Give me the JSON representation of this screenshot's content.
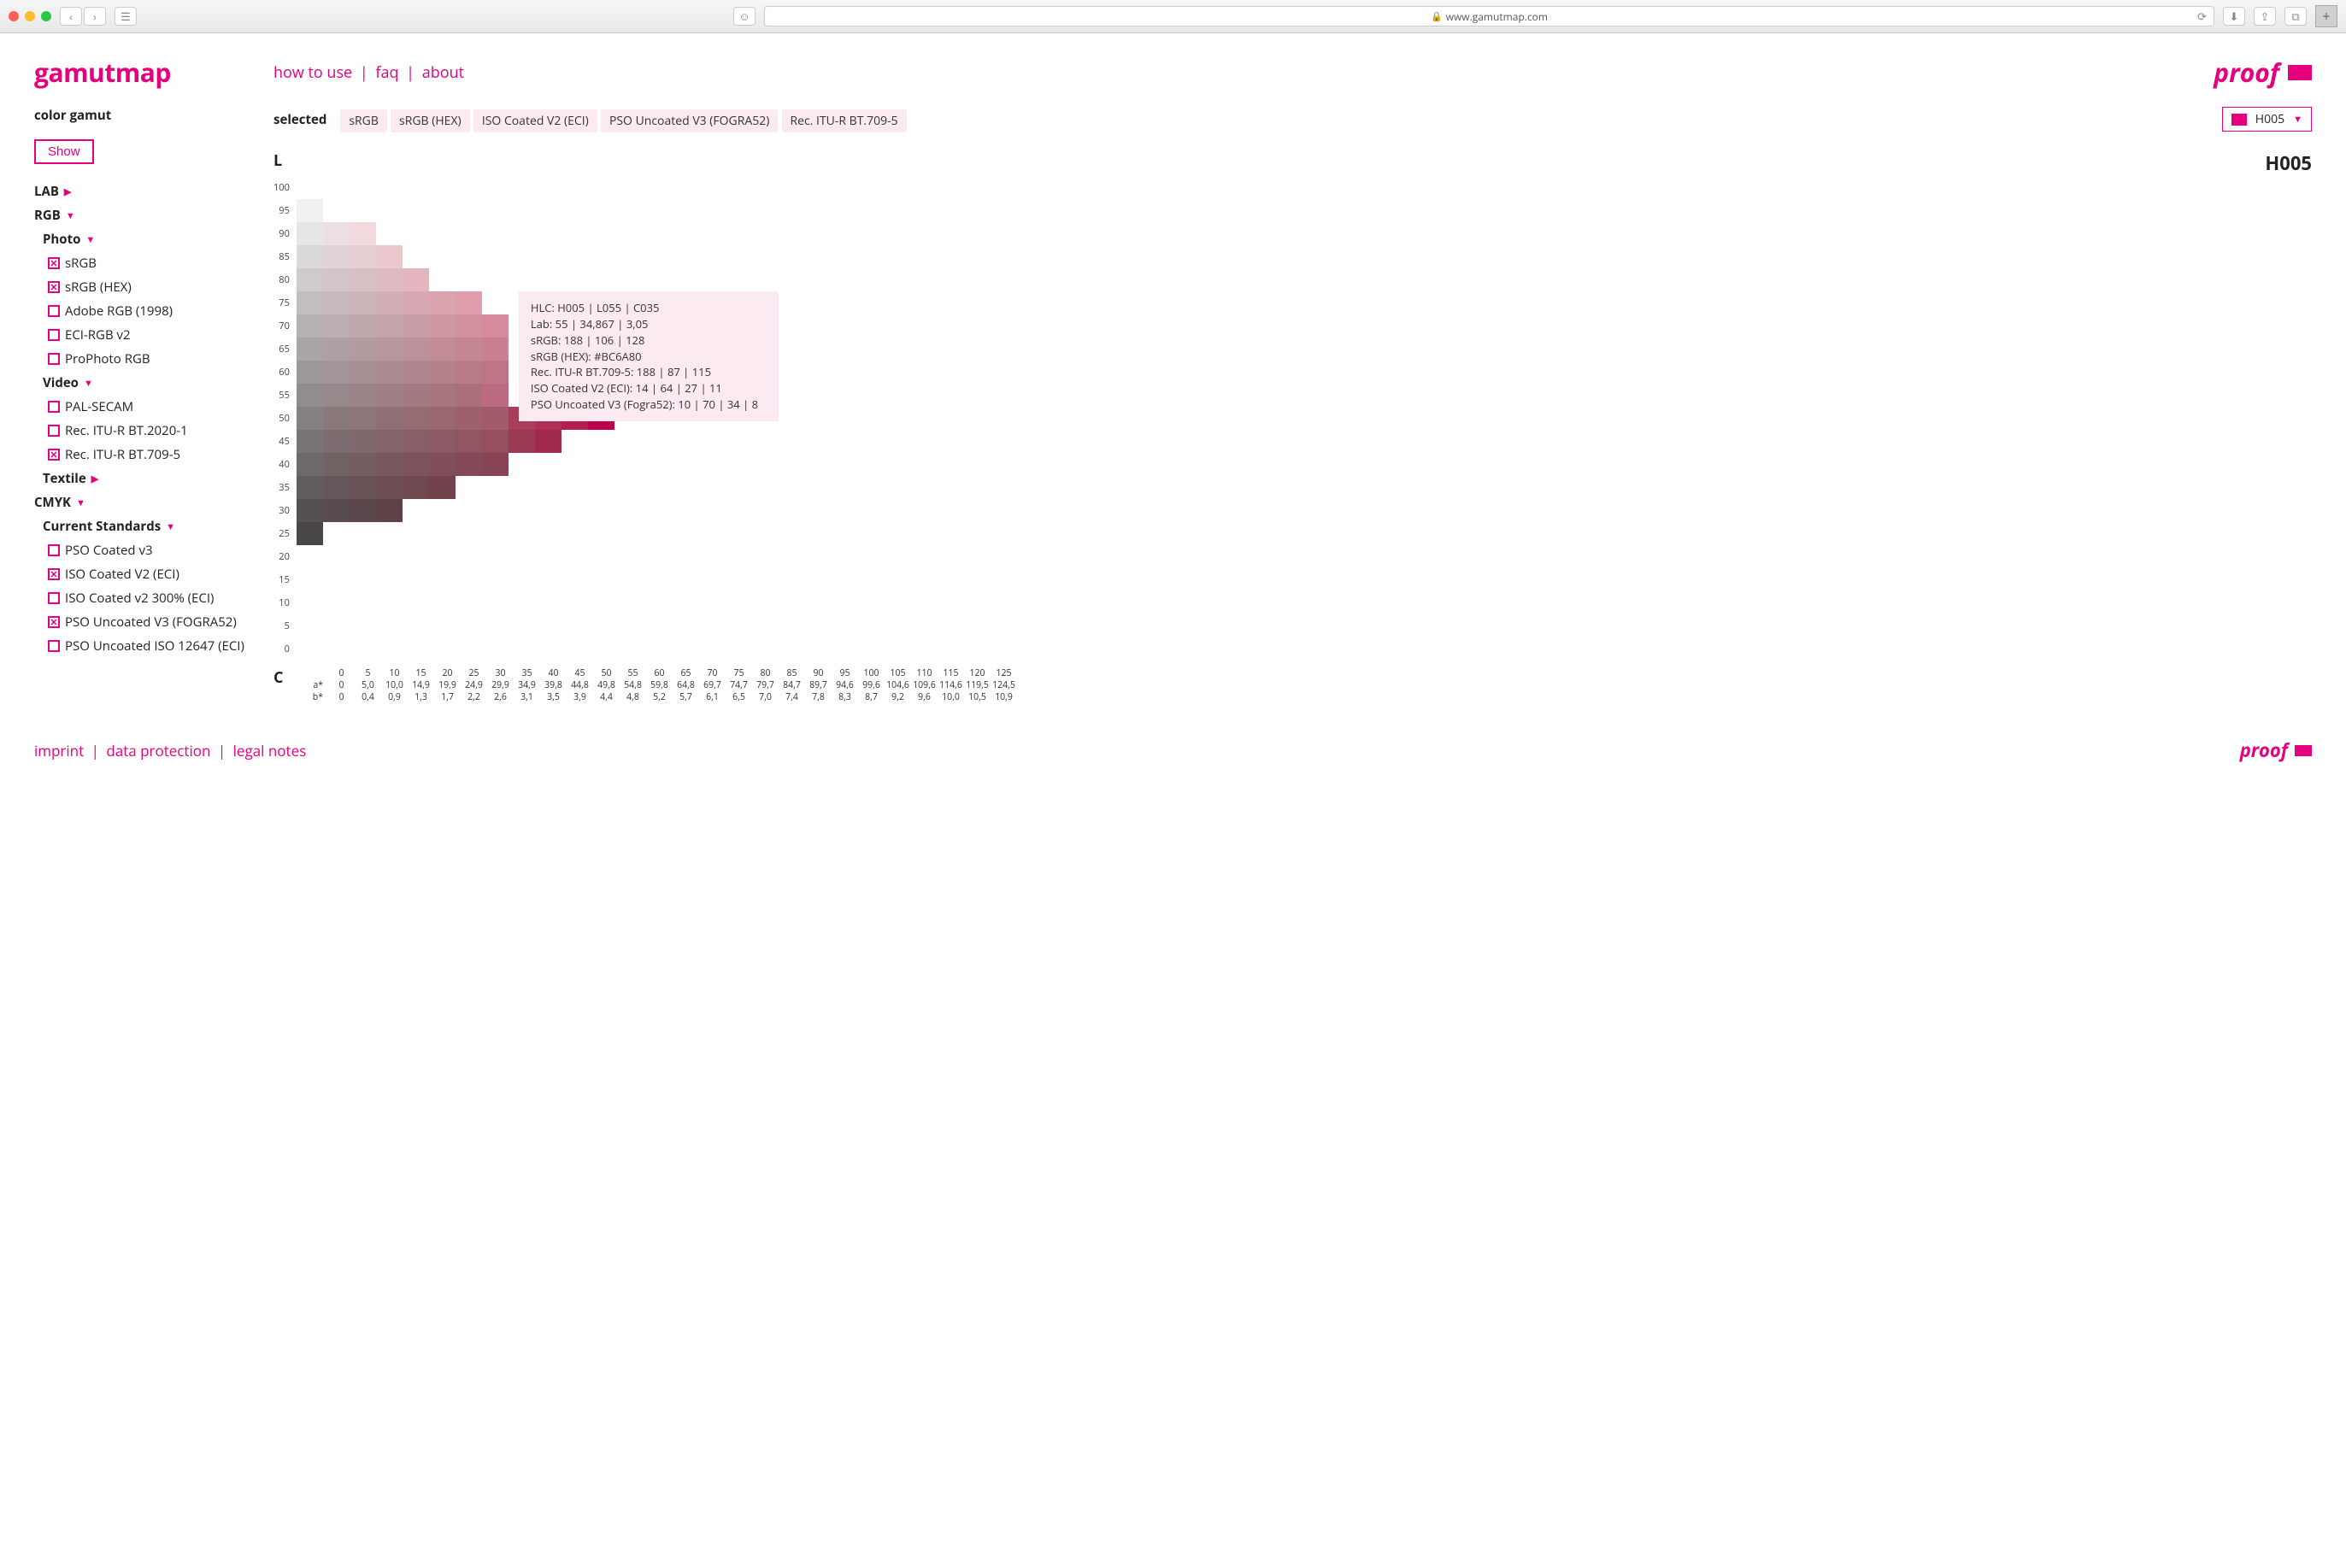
{
  "browser": {
    "url": "www.gamutmap.com"
  },
  "logo": "gamutmap",
  "sidebar": {
    "title": "color gamut",
    "show_btn": "Show",
    "lab": "LAB",
    "rgb": "RGB",
    "photo": "Photo",
    "srgb": "sRGB",
    "srgb_hex": "sRGB (HEX)",
    "adobe_rgb": "Adobe RGB (1998)",
    "eci_rgb": "ECI-RGB v2",
    "prophoto": "ProPhoto RGB",
    "video": "Video",
    "pal": "PAL-SECAM",
    "bt2020": "Rec. ITU-R BT.2020-1",
    "bt709": "Rec. ITU-R BT.709-5",
    "textile": "Textile",
    "cmyk": "CMYK",
    "current_std": "Current Standards",
    "pso_coated": "PSO Coated v3",
    "iso_coated": "ISO Coated V2 (ECI)",
    "iso_coated_300": "ISO Coated v2 300% (ECI)",
    "pso_uncoated": "PSO Uncoated V3 (FOGRA52)",
    "pso_uncoated_iso": "PSO Uncoated ISO 12647 (ECI)"
  },
  "nav": {
    "how_to_use": "how to use",
    "faq": "faq",
    "about": "about"
  },
  "proof": "proof",
  "selected": {
    "label": "selected",
    "chips": [
      "sRGB",
      "sRGB (HEX)",
      "ISO Coated V2 (ECI)",
      "PSO Uncoated V3 (FOGRA52)",
      "Rec. ITU-R BT.709-5"
    ]
  },
  "hue_select": "H005",
  "chart_title": "H005",
  "axis_l": "L",
  "axis_c": "C",
  "tooltip": {
    "l1": "HLC: H005 | L055 | C035",
    "l2": "Lab: 55 | 34,867 | 3,05",
    "l3": "sRGB: 188 | 106 | 128",
    "l4": "sRGB (HEX): #BC6A80",
    "l5": "Rec. ITU-R BT.709-5: 188 | 87 | 115",
    "l6": "ISO Coated V2 (ECI): 14 | 64 | 27 | 11",
    "l7": "PSO Uncoated V3 (Fogra52): 10 | 70 | 34 | 8"
  },
  "footer": {
    "imprint": "imprint",
    "data": "data protection",
    "legal": "legal notes"
  },
  "chart_data": {
    "type": "heatmap",
    "title": "H005",
    "ylabel": "L",
    "xlabel": "C",
    "y_ticks": [
      100,
      95,
      90,
      85,
      80,
      75,
      70,
      65,
      60,
      55,
      50,
      45,
      40,
      35,
      30,
      25,
      20,
      15,
      10,
      5,
      0
    ],
    "x_ticks_c": [
      0,
      5,
      10,
      15,
      20,
      25,
      30,
      35,
      40,
      45,
      50,
      55,
      60,
      65,
      70,
      75,
      80,
      85,
      90,
      95,
      100,
      105,
      110,
      115,
      120,
      125
    ],
    "x_ticks_a": [
      "0",
      "5,0",
      "10,0",
      "14,9",
      "19,9",
      "24,9",
      "29,9",
      "34,9",
      "39,8",
      "44,8",
      "49,8",
      "54,8",
      "59,8",
      "64,8",
      "69,7",
      "74,7",
      "79,7",
      "84,7",
      "89,7",
      "94,6",
      "99,6",
      "104,6",
      "109,6",
      "114,6",
      "119,5",
      "124,5"
    ],
    "x_ticks_b": [
      "0",
      "0,4",
      "0,9",
      "1,3",
      "1,7",
      "2,2",
      "2,6",
      "3,1",
      "3,5",
      "3,9",
      "4,4",
      "4,8",
      "5,2",
      "5,7",
      "6,1",
      "6,5",
      "7,0",
      "7,4",
      "7,8",
      "8,3",
      "8,7",
      "9,2",
      "9,6",
      "10,0",
      "10,5",
      "10,9"
    ],
    "x_row_labels": {
      "a": "a*",
      "b": "b*"
    },
    "rows": [
      {
        "L": 95,
        "cells": [
          "#f1f1f1"
        ]
      },
      {
        "L": 90,
        "cells": [
          "#e7e5e5",
          "#ecdfe2",
          "#f2d9de"
        ]
      },
      {
        "L": 85,
        "cells": [
          "#dbd8d8",
          "#e0d2d5",
          "#e5cdd1",
          "#ebc7ce"
        ]
      },
      {
        "L": 80,
        "cells": [
          "#cfcbcb",
          "#d3c6c9",
          "#d8c1c5",
          "#ddbbc1",
          "#e3b5be"
        ]
      },
      {
        "L": 75,
        "cells": [
          "#c2bebe",
          "#c7b9bc",
          "#ccb4b9",
          "#d1afb5",
          "#d6a9b2",
          "#dba3ae",
          "#e09dab"
        ]
      },
      {
        "L": 70,
        "cells": [
          "#b6b2b2",
          "#bbadb0",
          "#bfa8ac",
          "#c4a3a9",
          "#c99da5",
          "#ce97a2",
          "#d3919f",
          "#d88b9b"
        ]
      },
      {
        "L": 65,
        "cells": [
          "#aaa6a6",
          "#aea1a3",
          "#b39ca0",
          "#b7979d",
          "#bc9199",
          "#c18c96",
          "#c58693",
          "#ca8090"
        ]
      },
      {
        "L": 60,
        "cells": [
          "#9d9999",
          "#a29597",
          "#a69094",
          "#ab8b91",
          "#af868d",
          "#b4808a",
          "#b87b87",
          "#bd7584"
        ]
      },
      {
        "L": 55,
        "cells": [
          "#918d8d",
          "#95898b",
          "#9a8488",
          "#9e7f85",
          "#a27a81",
          "#a7757e",
          "#ab6f7b",
          "#bc6a80"
        ]
      },
      {
        "L": 50,
        "cells": [
          "#858181",
          "#89797b",
          "#8d7578",
          "#917075",
          "#966b72",
          "#9a666f",
          "#9e616c",
          "#a25b69",
          "#a93e5b",
          "#b02f55",
          "#b71c4f",
          "#bd0049"
        ]
      },
      {
        "L": 45,
        "cells": [
          "#797575",
          "#7d6d70",
          "#81686d",
          "#85636a",
          "#895e67",
          "#8d5964",
          "#915461",
          "#954f5e",
          "#9c3a53",
          "#a22b4d"
        ]
      },
      {
        "L": 40,
        "cells": [
          "#6d6969",
          "#716264",
          "#755d61",
          "#78585e",
          "#7c535b",
          "#804e58",
          "#844956",
          "#884453"
        ]
      },
      {
        "L": 35,
        "cells": [
          "#615d5d",
          "#645759",
          "#685256",
          "#6b4d53",
          "#6f4850",
          "#72434d"
        ]
      },
      {
        "L": 30,
        "cells": [
          "#555151",
          "#584c4e",
          "#5b474b",
          "#5e4248"
        ]
      },
      {
        "L": 25,
        "cells": [
          "#494646"
        ]
      }
    ]
  }
}
